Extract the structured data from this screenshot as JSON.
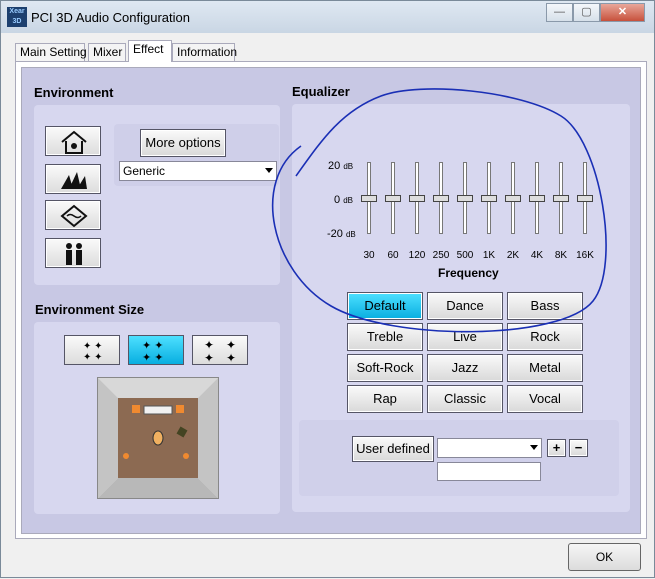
{
  "window": {
    "title": "PCI 3D Audio Configuration",
    "app_icon_text": "Xear 3D",
    "minimize": "—",
    "maximize": "▢",
    "close": "✕"
  },
  "tabs": [
    "Main Setting",
    "Mixer",
    "Effect",
    "Information"
  ],
  "active_tab": "Effect",
  "environment": {
    "title": "Environment",
    "more_options_label": "More options",
    "preset_value": "Generic"
  },
  "environment_size": {
    "title": "Environment Size",
    "selected_index": 1
  },
  "equalizer": {
    "title": "Equalizer",
    "db_labels": [
      "20",
      "0",
      "-20"
    ],
    "db_unit": "dB",
    "bands": [
      "30",
      "60",
      "120",
      "250",
      "500",
      "1K",
      "2K",
      "4K",
      "8K",
      "16K"
    ],
    "band_levels_db": [
      0,
      0,
      0,
      0,
      0,
      0,
      0,
      0,
      0,
      0
    ],
    "frequency_label": "Frequency",
    "presets": [
      "Default",
      "Dance",
      "Bass",
      "Treble",
      "Live",
      "Rock",
      "Soft-Rock",
      "Jazz",
      "Metal",
      "Rap",
      "Classic",
      "Vocal"
    ],
    "selected_preset": "Default",
    "user_defined_label": "User defined",
    "user_defined_value": "",
    "add": "+",
    "remove": "−"
  },
  "ok_label": "OK",
  "colors": {
    "accent": "#08aee0",
    "panel": "#c8c8e4",
    "annotation": "#1a2fb5"
  }
}
